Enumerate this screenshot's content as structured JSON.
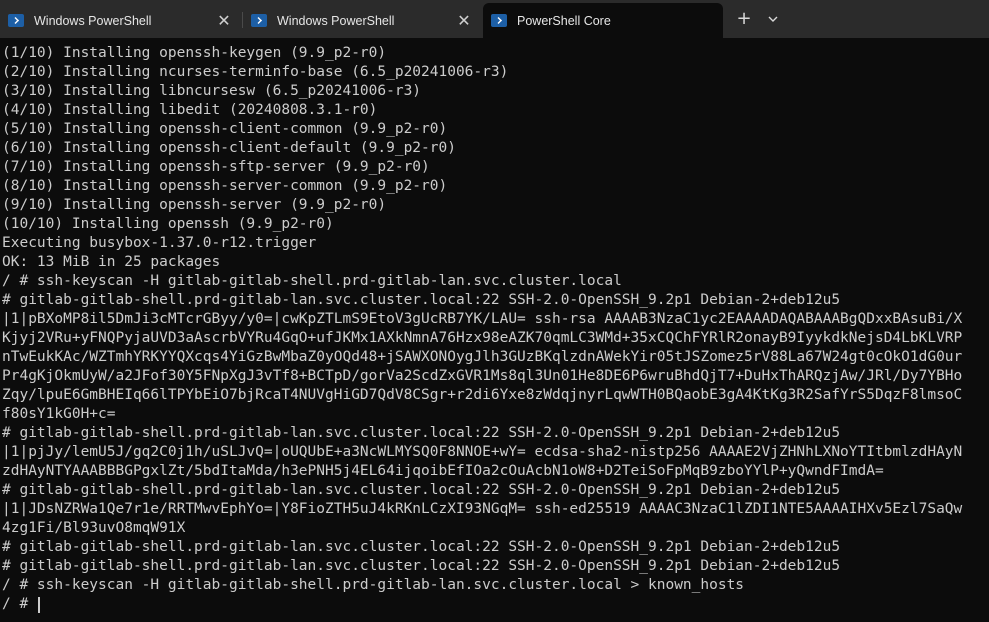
{
  "tabs": [
    {
      "title": "Windows PowerShell",
      "icon": "powershell-icon",
      "active": false
    },
    {
      "title": "Windows PowerShell",
      "icon": "powershell-icon",
      "active": false
    },
    {
      "title": "PowerShell Core",
      "icon": "powershell-icon",
      "active": true
    }
  ],
  "tabbar": {
    "close_glyph": "✕",
    "new_tab_glyph": "+",
    "dropdown_icon": "chevron-down-icon"
  },
  "console": {
    "lines": [
      "(1/10) Installing openssh-keygen (9.9_p2-r0)",
      "(2/10) Installing ncurses-terminfo-base (6.5_p20241006-r3)",
      "(3/10) Installing libncursesw (6.5_p20241006-r3)",
      "(4/10) Installing libedit (20240808.3.1-r0)",
      "(5/10) Installing openssh-client-common (9.9_p2-r0)",
      "(6/10) Installing openssh-client-default (9.9_p2-r0)",
      "(7/10) Installing openssh-sftp-server (9.9_p2-r0)",
      "(8/10) Installing openssh-server-common (9.9_p2-r0)",
      "(9/10) Installing openssh-server (9.9_p2-r0)",
      "(10/10) Installing openssh (9.9_p2-r0)",
      "Executing busybox-1.37.0-r12.trigger",
      "OK: 13 MiB in 25 packages",
      "/ # ssh-keyscan -H gitlab-gitlab-shell.prd-gitlab-lan.svc.cluster.local",
      "# gitlab-gitlab-shell.prd-gitlab-lan.svc.cluster.local:22 SSH-2.0-OpenSSH_9.2p1 Debian-2+deb12u5",
      "|1|pBXoMP8il5DmJi3cMTcrGByy/y0=|cwKpZTLmS9EtoV3gUcRB7YK/LAU= ssh-rsa AAAAB3NzaC1yc2EAAAADAQABAAABgQDxxBAsuBi/X",
      "Kjyj2VRu+yFNQPyjaUVD3aAscrbVYRu4GqO+ufJKMx1AXkNmnA76Hzx98eAZK70qmLC3WMd+35xCQChFYRlR2onayB9IyykdkNejsD4LbKLVRP",
      "nTwEukKAc/WZTmhYRKYYQXcqs4YiGzBwMbaZ0yOQd48+jSAWXONOygJlh3GUzBKqlzdnAWekYir05tJSZomez5rV88La67W24gt0cOkO1dG0ur",
      "Pr4gKjOkmUyW/a2JFof30Y5FNpXgJ3vTf8+BCTpD/gorVa2ScdZxGVR1Ms8ql3Un01He8DE6P6wruBhdQjT7+DuHxThARQzjAw/JRl/Dy7YBHo",
      "Zqy/lpuE6GmBHEIq66lTPYbEiO7bjRcaT4NUVgHiGD7QdV8CSgr+r2di6Yxe8zWdqjnyrLqwWTH0BQaobE3gA4KtKg3R2SafYrS5DqzF8lmsoC",
      "f80sY1kG0H+c=",
      "# gitlab-gitlab-shell.prd-gitlab-lan.svc.cluster.local:22 SSH-2.0-OpenSSH_9.2p1 Debian-2+deb12u5",
      "|1|pjJy/lemU5J/gq2C0j1h/uSLJvQ=|oUQUbE+a3NcWLMYSQ0F8NNOE+wY= ecdsa-sha2-nistp256 AAAAE2VjZHNhLXNoYTItbmlzdHAyN",
      "zdHAyNTYAAABBBGPgxlZt/5bdItaMda/h3ePNH5j4EL64ijqoibEfIOa2cOuAcbN1oW8+D2TeiSoFpMqB9zboYYlP+yQwndFImdA=",
      "# gitlab-gitlab-shell.prd-gitlab-lan.svc.cluster.local:22 SSH-2.0-OpenSSH_9.2p1 Debian-2+deb12u5",
      "|1|JDsNZRWa1Qe7r1e/RRTMwvEphYo=|Y8FioZTH5uJ4kRKnLCzXI93NGqM= ssh-ed25519 AAAAC3NzaC1lZDI1NTE5AAAAIHXv5Ezl7SaQw",
      "4zg1Fi/Bl93uvO8mqW91X",
      "# gitlab-gitlab-shell.prd-gitlab-lan.svc.cluster.local:22 SSH-2.0-OpenSSH_9.2p1 Debian-2+deb12u5",
      "# gitlab-gitlab-shell.prd-gitlab-lan.svc.cluster.local:22 SSH-2.0-OpenSSH_9.2p1 Debian-2+deb12u5",
      "/ # ssh-keyscan -H gitlab-gitlab-shell.prd-gitlab-lan.svc.cluster.local > known_hosts"
    ],
    "prompt": "/ #"
  },
  "colors": {
    "tabbar_bg": "#2b2b2b",
    "console_bg": "#0c0c0c",
    "console_text": "#cccccc",
    "icon_blue": "#1d5fa6"
  }
}
